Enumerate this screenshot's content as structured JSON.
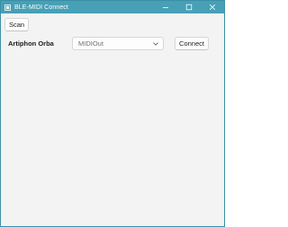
{
  "window": {
    "title": "BLE-MIDI Connect",
    "accent_color": "#47a0b5",
    "caption_icons": [
      "minimize-icon",
      "maximize-icon",
      "close-icon"
    ]
  },
  "toolbar": {
    "scan_label": "Scan"
  },
  "device": {
    "name": "Artiphon Orba",
    "midi_output_selected": "MIDIOut",
    "connect_label": "Connect"
  }
}
